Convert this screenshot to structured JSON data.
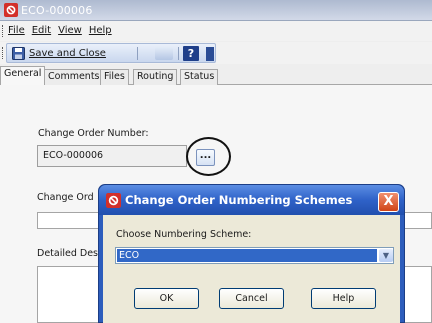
{
  "window": {
    "title": "ECO-000006",
    "icon": "eco-app-icon"
  },
  "menu": {
    "items": [
      "File",
      "Edit",
      "View",
      "Help"
    ]
  },
  "toolbar": {
    "save_label": "Save and Close",
    "save_icon": "floppy-disk-icon",
    "help_label": "?"
  },
  "tabs": [
    {
      "label": "General",
      "active": true
    },
    {
      "label": "Comments",
      "active": false
    },
    {
      "label": "Files",
      "active": false
    },
    {
      "label": "Routing",
      "active": false
    },
    {
      "label": "Status",
      "active": false
    }
  ],
  "form": {
    "change_order_label": "Change Order Number:",
    "change_order_value": "ECO-000006",
    "ellipsis_label": "...",
    "second_label_visible": "Change Ord",
    "details_label_visible": "Detailed Des"
  },
  "dialog": {
    "title": "Change Order Numbering Schemes",
    "close_label": "X",
    "scheme_label": "Choose Numbering Scheme:",
    "scheme_value": "ECO",
    "buttons": {
      "ok": "OK",
      "cancel": "Cancel",
      "help": "Help"
    }
  },
  "colors": {
    "dialog_title_blue": "#2f62c8",
    "selection_blue": "#3168c7",
    "close_red": "#d04416",
    "app_icon_red": "#d3302a"
  }
}
